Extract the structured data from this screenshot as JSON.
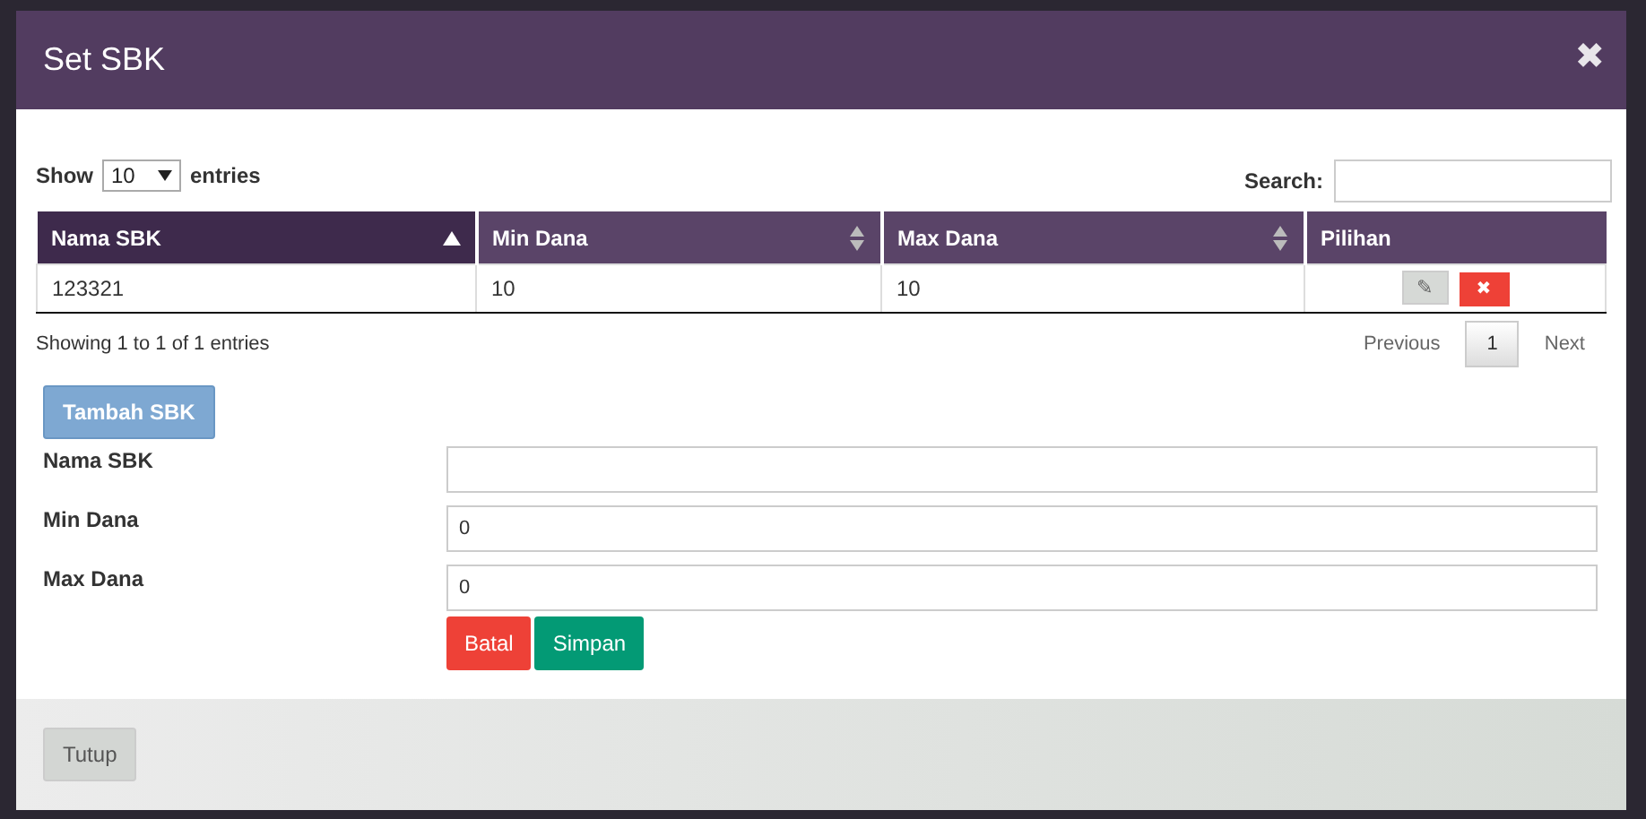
{
  "modal": {
    "title": "Set SBK",
    "close": "✖"
  },
  "table_controls": {
    "show_label": "Show",
    "page_length": "10",
    "entries_label": "entries",
    "search_label": "Search:"
  },
  "table": {
    "columns": [
      {
        "label": "Nama SBK",
        "sortable": true,
        "sorted": true
      },
      {
        "label": "Min Dana",
        "sortable": true,
        "sorted": false
      },
      {
        "label": "Max Dana",
        "sortable": true,
        "sorted": false
      },
      {
        "label": "Pilihan",
        "sortable": false,
        "sorted": false
      }
    ],
    "rows": [
      {
        "cells": [
          "123321",
          "10",
          "10"
        ],
        "edit": "✎",
        "delete": "✖"
      }
    ]
  },
  "info": "Showing 1 to 1 of 1 entries",
  "pagination": [
    {
      "label": "Previous",
      "selected": false
    },
    {
      "label": "1",
      "selected": true
    },
    {
      "label": "Next",
      "selected": false
    }
  ],
  "add_button": "Tambah SBK",
  "form": {
    "fields": [
      {
        "label": "Nama SBK"
      },
      {
        "label": "Min Dana",
        "value": "0"
      },
      {
        "label": "Max Dana",
        "value": "0"
      }
    ],
    "buttons": [
      {
        "label": "Batal",
        "kind": "danger"
      },
      {
        "label": "Simpan",
        "kind": "success"
      }
    ]
  },
  "footer": {
    "button": "Tutup"
  }
}
